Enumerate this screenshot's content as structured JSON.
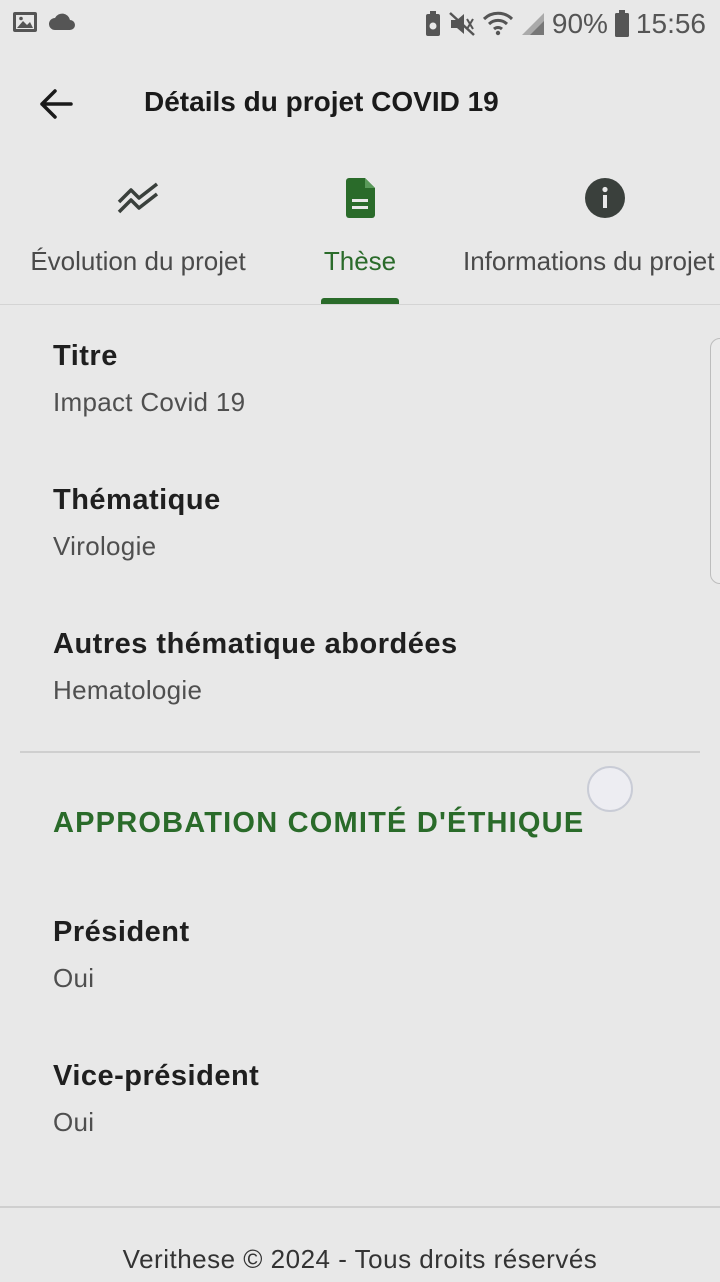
{
  "status_bar": {
    "battery_percent": "90%",
    "time": "15:56",
    "icons": [
      "image-icon",
      "cloud-icon",
      "battery-saver-icon",
      "mute-icon",
      "wifi-icon",
      "signal-icon",
      "battery-icon"
    ]
  },
  "app_bar": {
    "title": "Détails du projet COVID 19",
    "back_icon": "arrow-back-icon"
  },
  "tabs": [
    {
      "label": "Évolution du projet",
      "icon": "timeline-icon",
      "active": false
    },
    {
      "label": "Thèse",
      "icon": "document-icon",
      "active": true
    },
    {
      "label": "Informations du projet",
      "icon": "info-icon",
      "active": false
    }
  ],
  "thesis": {
    "fields": [
      {
        "label": "Titre",
        "value": "Impact Covid 19"
      },
      {
        "label": "Thématique",
        "value": "Virologie"
      },
      {
        "label": "Autres thématique abordées",
        "value": "Hematologie"
      }
    ]
  },
  "ethics": {
    "section_title": "APPROBATION COMITÉ D'ÉTHIQUE",
    "fields": [
      {
        "label": "Président",
        "value": "Oui"
      },
      {
        "label": "Vice-président",
        "value": "Oui"
      }
    ]
  },
  "footer": {
    "text": "Verithese © 2024 - Tous droits réservés"
  },
  "colors": {
    "accent": "#2a6b2a",
    "background": "#e8e8e8",
    "icon_dark": "#3a403c"
  }
}
